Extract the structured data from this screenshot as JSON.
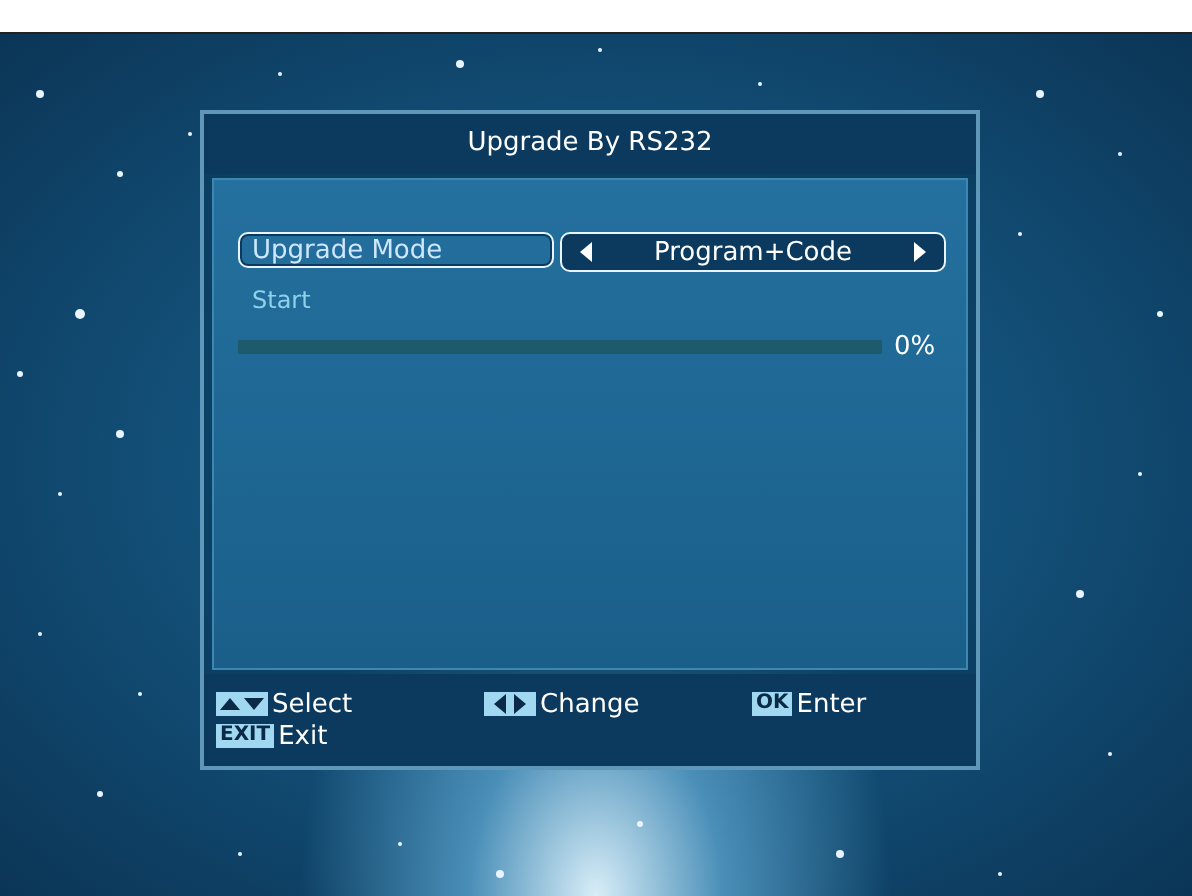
{
  "dialog": {
    "title": "Upgrade By RS232"
  },
  "items": [
    {
      "kind": "option",
      "label": "Upgrade Mode",
      "value": "Program+Code",
      "selected": true
    },
    {
      "kind": "action",
      "label": "Start",
      "selected": false
    }
  ],
  "progress": {
    "level": 0,
    "reading": "0%"
  },
  "hints": [
    {
      "kind": "updown",
      "label": "Select"
    },
    {
      "kind": "leftright",
      "label": "Change"
    },
    {
      "kind": "key",
      "key": "OK",
      "label": "Enter"
    },
    {
      "kind": "key",
      "key": "EXIT",
      "label": "Exit"
    }
  ]
}
